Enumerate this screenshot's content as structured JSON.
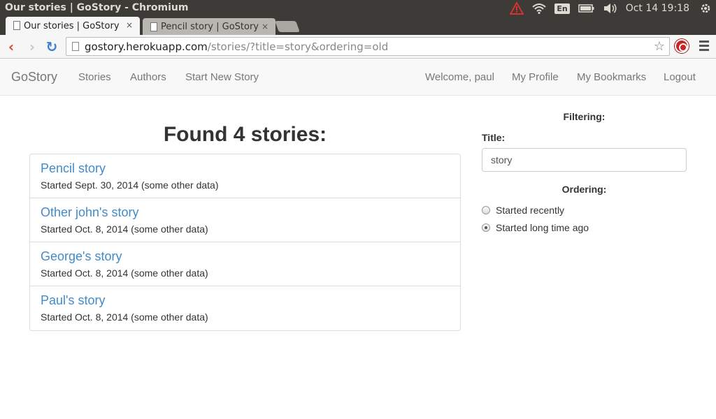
{
  "window": {
    "title": "Our stories | GoStory - Chromium",
    "tray": {
      "warning_icon": "warning-icon",
      "wifi_icon": "wifi-icon",
      "language": "En",
      "battery_icon": "battery-icon",
      "volume_icon": "volume-icon",
      "datetime": "Oct 14 19:18",
      "settings_icon": "gear-icon"
    }
  },
  "tabs": [
    {
      "label": "Our stories | GoStory",
      "close": "×",
      "active": true
    },
    {
      "label": "Pencil story | GoStory",
      "close": "×",
      "active": false
    }
  ],
  "toolbar": {
    "back": "‹",
    "forward": "›",
    "reload": "↻",
    "url_host": "gostory.herokuapp.com",
    "url_path": "/stories/?title=story&ordering=old",
    "star": "☆"
  },
  "navbar": {
    "brand": "GoStory",
    "left_links": [
      "Stories",
      "Authors",
      "Start New Story"
    ],
    "right_links": [
      "Welcome, paul",
      "My Profile",
      "My Bookmarks",
      "Logout"
    ]
  },
  "main": {
    "heading": "Found 4 stories:",
    "stories": [
      {
        "title": "Pencil story",
        "meta": "Started Sept. 30, 2014 (some other data)"
      },
      {
        "title": "Other john's story",
        "meta": "Started Oct. 8, 2014 (some other data)"
      },
      {
        "title": "George's story",
        "meta": "Started Oct. 8, 2014 (some other data)"
      },
      {
        "title": "Paul's story",
        "meta": "Started Oct. 8, 2014 (some other data)"
      }
    ]
  },
  "sidebar": {
    "filtering_heading": "Filtering:",
    "title_label": "Title:",
    "title_value": "story",
    "ordering_heading": "Ordering:",
    "options": [
      {
        "label": "Started recently",
        "checked": false
      },
      {
        "label": "Started long time ago",
        "checked": true
      }
    ]
  },
  "colors": {
    "link": "#428bca",
    "navbar_bg": "#f8f8f8",
    "os_bar": "#3c3b37"
  }
}
